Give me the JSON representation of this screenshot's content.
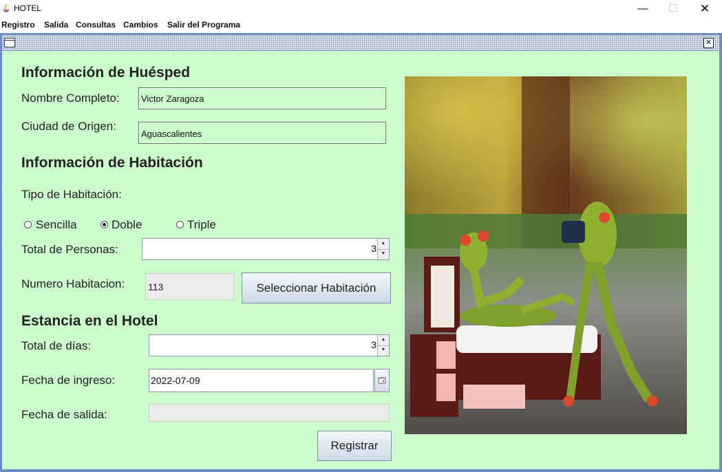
{
  "window": {
    "title": "HOTEL",
    "minimize": "—",
    "maximize": "☐",
    "close": "✕"
  },
  "menu": [
    "Registro",
    "Salida",
    "Consultas",
    "Cambios",
    "Salir del Programa"
  ],
  "guest": {
    "heading": "Información de Huésped",
    "name_label": "Nombre Completo:",
    "name_value": "Victor Zaragoza",
    "city_label": "Ciudad de Origen:",
    "city_value": "Aguascalientes"
  },
  "room": {
    "heading": "Información de Habitación",
    "type_label": "Tipo de Habitación:",
    "options": [
      "Sencilla",
      "Doble",
      "Triple"
    ],
    "selected_option": "Doble",
    "persons_label": "Total de Personas:",
    "persons_value": "3",
    "number_label": "Numero Habitacion:",
    "number_value": "113",
    "select_button": "Seleccionar Habitación"
  },
  "stay": {
    "heading": "Estancia en el Hotel",
    "days_label": "Total de días:",
    "days_value": "3",
    "checkin_label": "Fecha de ingreso:",
    "checkin_value": "2022-07-09",
    "checkout_label": "Fecha de salida:",
    "checkout_value": ""
  },
  "register_button": "Registrar",
  "colors": {
    "content_bg": "#ccfccc",
    "frame_border": "#6d8fbf"
  }
}
